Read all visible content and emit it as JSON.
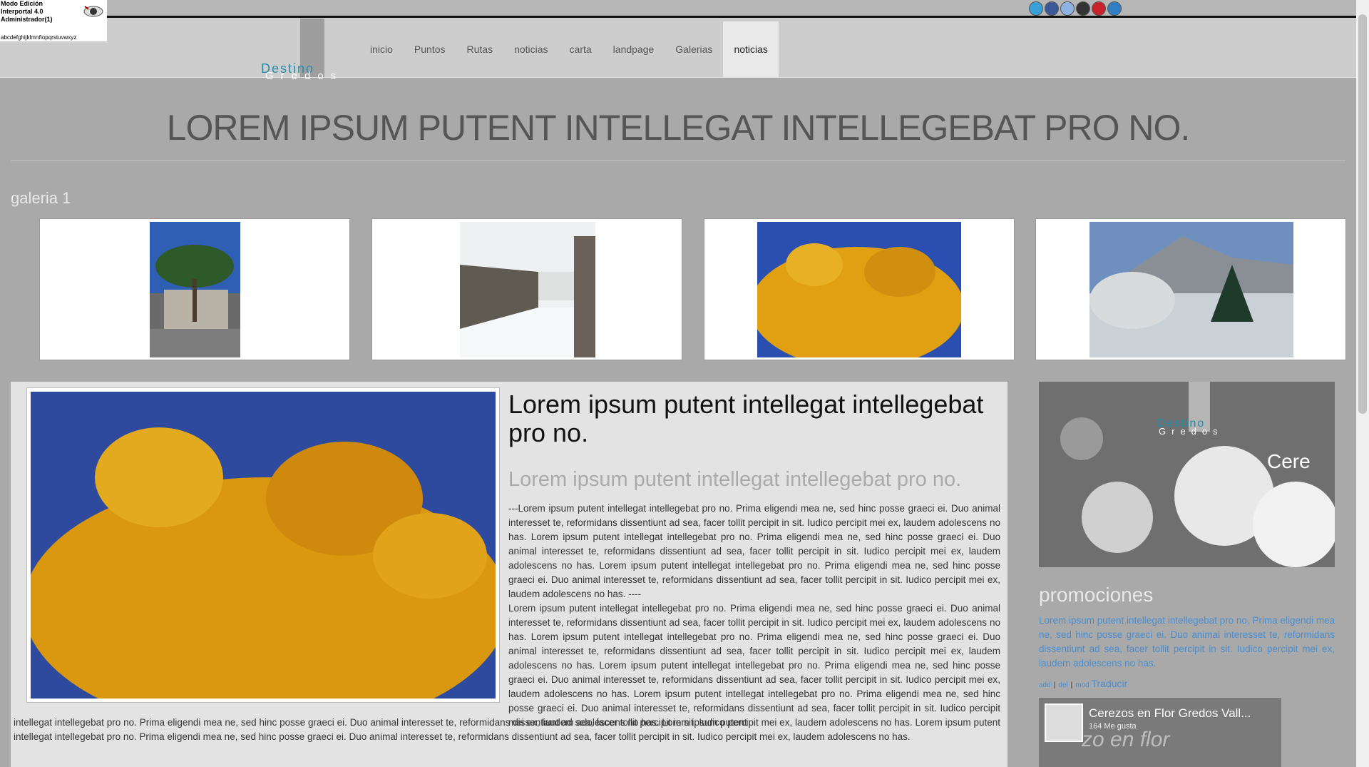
{
  "admin": {
    "line1": "Modo Edición",
    "line2": "Interportal 4.0",
    "line3": "Administrador(1)",
    "alphabet": "abcdefghijklmnñopqrstuvwxyz"
  },
  "logo": {
    "top": "Destino",
    "bottom": "Gredos"
  },
  "nav": [
    "inicio",
    "Puntos",
    "Rutas",
    "noticias",
    "carta",
    "landpage",
    "Galerias",
    "noticias"
  ],
  "nav_active_index": 7,
  "social_icons": [
    "twitter-icon",
    "facebook-icon",
    "delicious-icon",
    "google-plus-icon",
    "pinterest-icon",
    "share-icon"
  ],
  "headline": "LOREM IPSUM PUTENT INTELLEGAT INTELLEGEBAT PRO NO.",
  "gallery": {
    "title": "galeria 1",
    "images": [
      "pine-tree-house",
      "snowy-stone-wall-street",
      "yellow-autumn-tree",
      "snowy-mountain-path"
    ]
  },
  "article": {
    "title": "Lorem ipsum putent intellegat intellegebat pro no.",
    "subtitle": "Lorem ipsum putent intellegat intellegebat pro no.",
    "body": "---Lorem ipsum putent intellegat intellegebat pro no. Prima eligendi mea ne, sed hinc posse graeci ei. Duo animal interesset te, reformidans dissentiunt ad sea, facer tollit percipit in sit. Iudico percipit mei ex, laudem adolescens no has. Lorem ipsum putent intellegat intellegebat pro no. Prima eligendi mea ne, sed hinc posse graeci ei. Duo animal interesset te, reformidans dissentiunt ad sea, facer tollit percipit in sit. Iudico percipit mei ex, laudem adolescens no has. Lorem ipsum putent intellegat intellegebat pro no. Prima eligendi mea ne, sed hinc posse graeci ei. Duo animal interesset te, reformidans dissentiunt ad sea, facer tollit percipit in sit. Iudico percipit mei ex, laudem adolescens no has. ----",
    "body2": "Lorem ipsum putent intellegat intellegebat pro no. Prima eligendi mea ne, sed hinc posse graeci ei. Duo animal interesset te, reformidans dissentiunt ad sea, facer tollit percipit in sit. Iudico percipit mei ex, laudem adolescens no has. Lorem ipsum putent intellegat intellegebat pro no. Prima eligendi mea ne, sed hinc posse graeci ei. Duo animal interesset te, reformidans dissentiunt ad sea, facer tollit percipit in sit. Iudico percipit mei ex, laudem adolescens no has. Lorem ipsum putent intellegat intellegebat pro no. Prima eligendi mea ne, sed hinc posse graeci ei. Duo animal interesset te, reformidans dissentiunt ad sea, facer tollit percipit in sit. Iudico percipit mei ex, laudem adolescens no has. Lorem ipsum putent intellegat intellegebat pro no. Prima eligendi mea ne, sed hinc posse graeci ei. Duo animal interesset te, reformidans dissentiunt ad sea, facer tollit percipit in sit. Iudico percipit mei ex, laudem adolescens no has. Lorem ipsum putent",
    "body3": "intellegat intellegebat pro no. Prima eligendi mea ne, sed hinc posse graeci ei. Duo animal interesset te, reformidans dissentiunt ad sea, facer tollit percipit in sit. Iudico percipit mei ex, laudem adolescens no has. Lorem ipsum putent intellegat intellegebat pro no. Prima eligendi mea ne, sed hinc posse graeci ei. Duo animal interesset te, reformidans dissentiunt ad sea, facer tollit percipit in sit. Iudico percipit mei ex, laudem adolescens no has."
  },
  "sidebar": {
    "banner": {
      "logo_top": "Destino",
      "logo_bottom": "Gredos",
      "caption": "Cere"
    },
    "promo_title": "promociones",
    "promo_text": "Lorem ipsum putent intellegat intellegebat pro no. Prima eligendi mea ne, sed hinc posse graeci ei. Duo animal interesset te, reformidans dissentiunt ad sea, facer tollit percipit in sit. Iudico percipit mei ex, laudem adolescens no has.",
    "links": {
      "add": "add",
      "del": "del",
      "mod": "mod",
      "translate": "Traducir"
    },
    "facebook": {
      "title": "Cerezos en Flor Gredos Vall...",
      "likes": "164 Me gusta",
      "bg_text": "zo en flor"
    }
  },
  "colors": {
    "accent": "#2a8ba8",
    "link": "#4a8ed0",
    "page_bg": "#a9a9a9",
    "nav_bg": "#cdcdcd"
  }
}
